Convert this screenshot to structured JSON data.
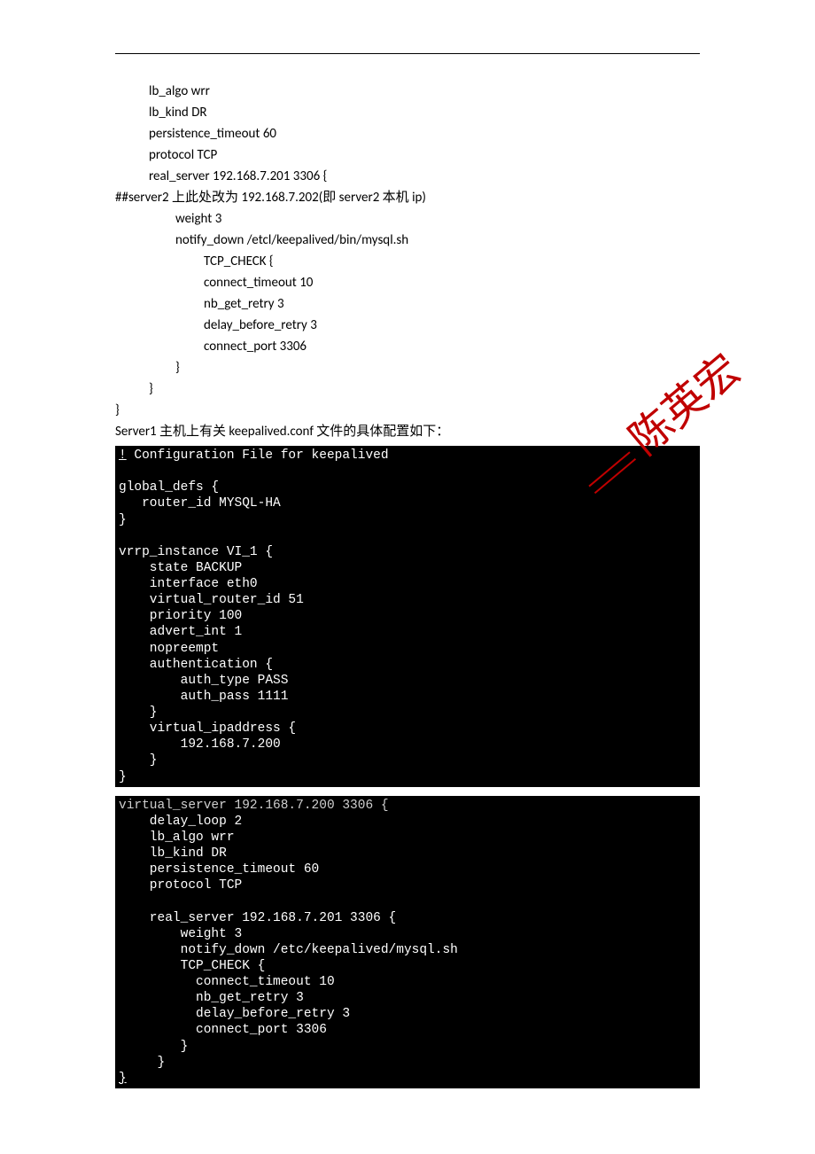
{
  "config": {
    "l1": "lb_algo wrr",
    "l2": "lb_kind DR",
    "l3": "persistence_timeout 60",
    "l4": "protocol TCP",
    "l5": "real_server 192.168.7.201 3306 {",
    "comment": "##server2 上此处改为 192.168.7.202(即 server2 本机 ip)",
    "l6": "weight 3",
    "l7": "notify_down /etcl/keepalived/bin/mysql.sh",
    "l8": "TCP_CHECK {",
    "l9": "connect_timeout 10",
    "l10": "nb_get_retry 3",
    "l11": "delay_before_retry 3",
    "l12": "connect_port 3306",
    "l13": "}",
    "l14": "}",
    "l15": "}"
  },
  "caption": "Server1 主机上有关 keepalived.conf 文件的具体配置如下：",
  "term1": {
    "l1_a": "!",
    "l1_b": " Configuration File for keepalived",
    "l2": "",
    "l3": "global_defs {",
    "l4": "   router_id MYSQL-HA",
    "l5": "}",
    "l6": "",
    "l7": "vrrp_instance VI_1 {",
    "l8": "    state BACKUP",
    "l9": "    interface eth0",
    "l10": "    virtual_router_id 51",
    "l11": "    priority 100",
    "l12": "    advert_int 1",
    "l13": "    nopreempt",
    "l14": "    authentication {",
    "l15": "        auth_type PASS",
    "l16": "        auth_pass 1111",
    "l17": "    }",
    "l18": "    virtual_ipaddress {",
    "l19": "        192.168.7.200",
    "l20": "    }",
    "l21": "}"
  },
  "term2": {
    "l1": "virtual_server 192.168.7.200 3306 {",
    "l2": "    delay_loop 2",
    "l3": "    lb_algo wrr",
    "l4": "    lb_kind DR",
    "l5": "    persistence_timeout 60",
    "l6": "    protocol TCP",
    "l7": "",
    "l8": "    real_server 192.168.7.201 3306 {",
    "l9": "        weight 3",
    "l10": "        notify_down /etc/keepalived/mysql.sh",
    "l11": "        TCP_CHECK {",
    "l12": "          connect_timeout 10",
    "l13": "          nb_get_retry 3",
    "l14": "          delay_before_retry 3",
    "l15": "          connect_port 3306",
    "l16": "        }",
    "l17": "     }",
    "l18_a": "}",
    "l18_b": "                                                                       "
  },
  "watermark_text": "陈英宏"
}
